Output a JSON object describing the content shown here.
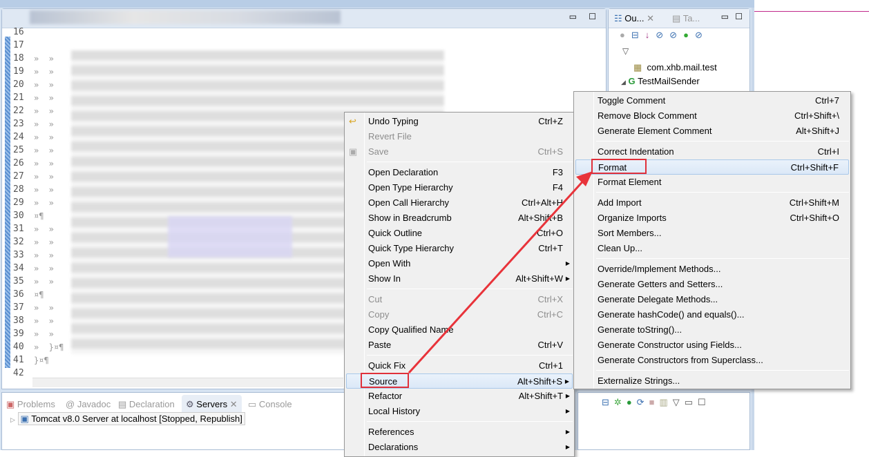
{
  "editor": {
    "line_numbers": [
      "16",
      "17",
      "18",
      "19",
      "20",
      "21",
      "22",
      "23",
      "24",
      "25",
      "26",
      "27",
      "28",
      "29",
      "30",
      "31",
      "32",
      "33",
      "34",
      "35",
      "36",
      "37",
      "38",
      "39",
      "40",
      "41",
      "42"
    ],
    "visible_code": {
      "30": "¤¶",
      "36": "¤¶",
      "40": "»  }¤¶",
      "41": "}¤¶"
    },
    "tab_marker": "»  »"
  },
  "outline": {
    "tabs": [
      {
        "label": "Ou...",
        "icon": "outline-icon"
      },
      {
        "label": "Ta...",
        "icon": "task-list-icon"
      }
    ],
    "tree": [
      {
        "label": "com.xhb.mail.test",
        "icon": "package-icon"
      },
      {
        "label": "TestMailSender",
        "icon": "class-icon"
      }
    ]
  },
  "bottom_panel": {
    "tabs": [
      {
        "label": "Problems"
      },
      {
        "label": "Javadoc"
      },
      {
        "label": "Declaration"
      },
      {
        "label": "Servers",
        "active": true
      },
      {
        "label": "Console"
      }
    ],
    "server": "Tomcat v8.0 Server at localhost  [Stopped, Republish]"
  },
  "context_menu": {
    "items": [
      {
        "label": "Undo Typing",
        "shortcut": "Ctrl+Z",
        "icon": "undo-icon"
      },
      {
        "label": "Revert File",
        "disabled": true
      },
      {
        "label": "Save",
        "shortcut": "Ctrl+S",
        "disabled": true,
        "icon": "save-icon"
      },
      {
        "sep": true
      },
      {
        "label": "Open Declaration",
        "shortcut": "F3"
      },
      {
        "label": "Open Type Hierarchy",
        "shortcut": "F4"
      },
      {
        "label": "Open Call Hierarchy",
        "shortcut": "Ctrl+Alt+H"
      },
      {
        "label": "Show in Breadcrumb",
        "shortcut": "Alt+Shift+B"
      },
      {
        "label": "Quick Outline",
        "shortcut": "Ctrl+O"
      },
      {
        "label": "Quick Type Hierarchy",
        "shortcut": "Ctrl+T"
      },
      {
        "label": "Open With",
        "submenu": true
      },
      {
        "label": "Show In",
        "shortcut": "Alt+Shift+W",
        "submenu": true
      },
      {
        "sep": true
      },
      {
        "label": "Cut",
        "shortcut": "Ctrl+X",
        "disabled": true
      },
      {
        "label": "Copy",
        "shortcut": "Ctrl+C",
        "disabled": true
      },
      {
        "label": "Copy Qualified Name"
      },
      {
        "label": "Paste",
        "shortcut": "Ctrl+V"
      },
      {
        "sep": true
      },
      {
        "label": "Quick Fix",
        "shortcut": "Ctrl+1"
      },
      {
        "label": "Source",
        "shortcut": "Alt+Shift+S",
        "submenu": true,
        "highlighted": true
      },
      {
        "label": "Refactor",
        "shortcut": "Alt+Shift+T",
        "submenu": true
      },
      {
        "label": "Local History",
        "submenu": true
      },
      {
        "sep": true
      },
      {
        "label": "References",
        "submenu": true
      },
      {
        "label": "Declarations",
        "submenu": true
      }
    ]
  },
  "source_submenu": {
    "items": [
      {
        "label": "Toggle Comment",
        "shortcut": "Ctrl+7"
      },
      {
        "label": "Remove Block Comment",
        "shortcut": "Ctrl+Shift+\\"
      },
      {
        "label": "Generate Element Comment",
        "shortcut": "Alt+Shift+J"
      },
      {
        "sep": true
      },
      {
        "label": "Correct Indentation",
        "shortcut": "Ctrl+I"
      },
      {
        "label": "Format",
        "shortcut": "Ctrl+Shift+F",
        "highlighted": true
      },
      {
        "label": "Format Element"
      },
      {
        "sep": true
      },
      {
        "label": "Add Import",
        "shortcut": "Ctrl+Shift+M"
      },
      {
        "label": "Organize Imports",
        "shortcut": "Ctrl+Shift+O"
      },
      {
        "label": "Sort Members..."
      },
      {
        "label": "Clean Up..."
      },
      {
        "sep": true
      },
      {
        "label": "Override/Implement Methods..."
      },
      {
        "label": "Generate Getters and Setters..."
      },
      {
        "label": "Generate Delegate Methods..."
      },
      {
        "label": "Generate hashCode() and equals()..."
      },
      {
        "label": "Generate toString()..."
      },
      {
        "label": "Generate Constructor using Fields..."
      },
      {
        "label": "Generate Constructors from Superclass..."
      },
      {
        "sep": true
      },
      {
        "label": "Externalize Strings..."
      }
    ]
  },
  "colors": {
    "annotation_red": "#e8333a",
    "highlight": "#dbe8f7",
    "accent_magenta": "#c0288a"
  }
}
